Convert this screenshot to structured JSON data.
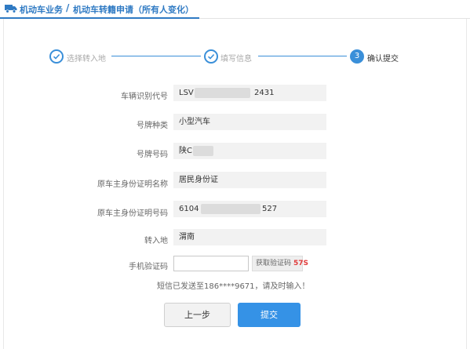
{
  "breadcrumb": {
    "parent": "机动车业务",
    "separator": "/",
    "current": "机动车转籍申请（所有人变化）"
  },
  "steps": [
    {
      "label": "选择转入地",
      "state": "done"
    },
    {
      "label": "填写信息",
      "state": "done"
    },
    {
      "label": "确认提交",
      "state": "current",
      "number": "3"
    }
  ],
  "form": {
    "vin": {
      "label": "车辆识别代号",
      "prefix": "LSV",
      "suffix": "2431"
    },
    "plate_type": {
      "label": "号牌种类",
      "value": "小型汽车"
    },
    "plate_number": {
      "label": "号牌号码",
      "prefix": "陕C"
    },
    "id_type": {
      "label": "原车主身份证明名称",
      "value": "居民身份证"
    },
    "id_number": {
      "label": "原车主身份证明号码",
      "prefix": "6104",
      "suffix": "527"
    },
    "destination": {
      "label": "转入地",
      "value": "渭南"
    },
    "sms": {
      "label": "手机验证码",
      "input_value": "",
      "button_label": "获取验证码",
      "countdown": "57S"
    }
  },
  "hint": "短信已发送至186****9671，请及时输入！",
  "buttons": {
    "prev": "上一步",
    "submit": "提交"
  },
  "colors": {
    "accent": "#3a8fd9",
    "submit_bg": "#3592e6",
    "countdown": "#e03c3c"
  }
}
